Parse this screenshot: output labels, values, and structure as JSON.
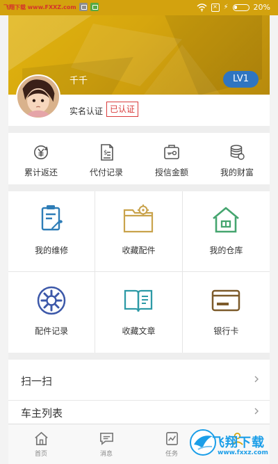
{
  "status": {
    "source": "飞翔下载 www.FXXZ.com",
    "battery": "20%"
  },
  "profile": {
    "name": "千千",
    "level": "LV1",
    "verify_label": "实名认证",
    "verify_status": "已认证"
  },
  "finance_items": [
    {
      "label": "累计返还",
      "icon": "yuan-cycle-icon"
    },
    {
      "label": "代付记录",
      "icon": "receipt-icon"
    },
    {
      "label": "授信金额",
      "icon": "card-key-icon"
    },
    {
      "label": "我的财富",
      "icon": "coins-icon"
    }
  ],
  "grid_items": [
    {
      "label": "我的维修",
      "icon": "repair-icon"
    },
    {
      "label": "收藏配件",
      "icon": "folder-gear-icon"
    },
    {
      "label": "我的仓库",
      "icon": "warehouse-icon"
    },
    {
      "label": "配件记录",
      "icon": "gear-icon"
    },
    {
      "label": "收藏文章",
      "icon": "book-icon"
    },
    {
      "label": "银行卡",
      "icon": "bank-card-icon"
    }
  ],
  "list_items": [
    {
      "label": "扫一扫"
    },
    {
      "label": "车主列表"
    }
  ],
  "tabs": [
    {
      "label": "首页",
      "icon": "home-icon"
    },
    {
      "label": "消息",
      "icon": "message-icon"
    },
    {
      "label": "任务",
      "icon": "task-icon"
    },
    {
      "label": "",
      "icon": "profile-icon"
    }
  ],
  "watermark": {
    "title": "飞翔下载",
    "subtitle": "www.fxxz.com"
  },
  "colors": {
    "accent": "#d6a60e",
    "level_blue": "#2f75c1",
    "verified_red": "#d93b3b",
    "icon_dark": "#444444",
    "icon_blue": "#2e7db7",
    "icon_gold": "#c9a34c",
    "icon_green": "#45a56f",
    "icon_navy": "#3c58a9",
    "icon_teal": "#2d9aa6",
    "icon_brown": "#7c5a2a"
  }
}
